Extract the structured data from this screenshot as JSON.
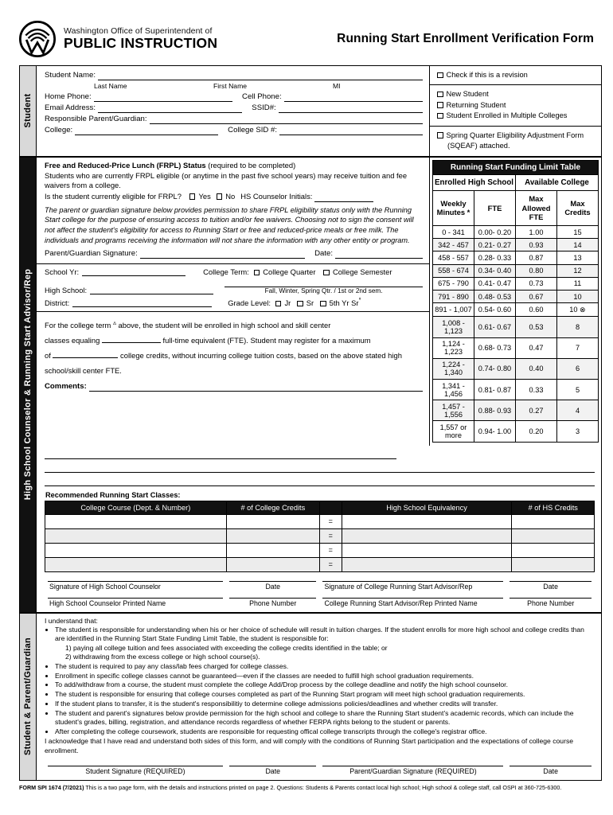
{
  "header": {
    "agency_line1": "Washington Office of Superintendent of",
    "agency_line2": "PUBLIC INSTRUCTION",
    "form_title": "Running Start Enrollment Verification Form",
    "logo_icon": "ospi-seal-icon"
  },
  "sidebars": {
    "student": "Student",
    "counselor": "High School Counselor & Running Start Advisor/Rep",
    "parent": "Student & Parent/Guardian"
  },
  "student": {
    "name_label": "Student Name:",
    "cap_last": "Last Name",
    "cap_first": "First Name",
    "cap_mi": "MI",
    "home_phone_label": "Home Phone:",
    "cell_phone_label": "Cell Phone:",
    "email_label": "Email Address:",
    "ssid_label": "SSID#:",
    "guardian_label": "Responsible Parent/Guardian:",
    "college_label": "College:",
    "college_sid_label": "College SID #:",
    "checks_group1": [
      "Check if this is a revision"
    ],
    "checks_group2": [
      "New Student",
      "Returning Student",
      "Student Enrolled in Multiple Colleges"
    ],
    "checks_group3": [
      "Spring Quarter Eligibility Adjustment Form (SQEAF) attached."
    ]
  },
  "frpl": {
    "heading_bold": "Free and Reduced-Price Lunch (FRPL) Status",
    "heading_rest": " (required to be completed)",
    "body": "Students who are currently FRPL eligible (or anytime in the past five school years) may receive tuition and fee waivers from a college.",
    "question": "Is the student currently eligible for FRPL?",
    "opt_yes": "Yes",
    "opt_no": "No",
    "initials_label": "HS Counselor Initials:",
    "consent": "The parent or guardian signature below provides permission to share FRPL eligibility status only with the Running Start college for the purpose of ensuring access to tuition and/or fee waivers. Choosing not to sign the consent will not affect the student's eligibility for access to Running Start or free and reduced-price meals or free milk. The individuals and programs receiving the information will not share the information with any other entity or program.",
    "signature_label": "Parent/Guardian Signature:",
    "date_label": "Date:"
  },
  "school": {
    "school_yr_label": "School Yr:",
    "college_term_label": "College Term:",
    "term_quarter": "College Quarter",
    "term_semester": "College Semester",
    "high_school_label": "High School:",
    "term_caption": "Fall, Winter, Spring Qtr. / 1st or 2nd sem.",
    "district_label": "District:",
    "grade_level_label": "Grade Level:",
    "grade_jr": "Jr",
    "grade_sr": "Sr",
    "grade_5th": "5th Yr Sr",
    "grade_5th_sup": "°"
  },
  "enrollment": {
    "line1_a": "For the college term ",
    "line1_sup": "▵",
    "line1_b": " above, the student will be enrolled in high school and skill center",
    "line2_a": "classes equaling",
    "line2_b": "full-time equivalent (FTE).  Student may register for a maximum",
    "line3_a": "of",
    "line3_b": "college credits, without incurring college tuition costs, based on the above stated high school/skill center FTE.",
    "comments_label": "Comments:"
  },
  "chart_data": {
    "type": "table",
    "title": "Running Start Funding Limit Table",
    "group_headers": [
      "Enrolled High School",
      "Available College"
    ],
    "columns": [
      "Weekly Minutes *",
      "FTE",
      "Max Allowed FTE",
      "Max Credits"
    ],
    "rows": [
      [
        "0 - 341",
        "0.00- 0.20",
        "1.00",
        "15"
      ],
      [
        "342 - 457",
        "0.21- 0.27",
        "0.93",
        "14"
      ],
      [
        "458 - 557",
        "0.28- 0.33",
        "0.87",
        "13"
      ],
      [
        "558 - 674",
        "0.34- 0.40",
        "0.80",
        "12"
      ],
      [
        "675 - 790",
        "0.41- 0.47",
        "0.73",
        "11"
      ],
      [
        "791 - 890",
        "0.48- 0.53",
        "0.67",
        "10"
      ],
      [
        "891 - 1,007",
        "0.54- 0.60",
        "0.60",
        "10 ⊗"
      ],
      [
        "1,008 - 1,123",
        "0.61- 0.67",
        "0.53",
        "8"
      ],
      [
        "1,124 - 1,223",
        "0.68- 0.73",
        "0.47",
        "7"
      ],
      [
        "1,224 - 1,340",
        "0.74- 0.80",
        "0.40",
        "6"
      ],
      [
        "1,341 - 1,456",
        "0.81- 0.87",
        "0.33",
        "5"
      ],
      [
        "1,457 - 1,556",
        "0.88- 0.93",
        "0.27",
        "4"
      ],
      [
        "1,557 or more",
        "0.94- 1.00",
        "0.20",
        "3"
      ]
    ]
  },
  "classes": {
    "label": "Recommended Running Start Classes:",
    "headers": [
      "College Course (Dept. & Number)",
      "# of College Credits",
      "",
      "High School Equivalency",
      "# of HS Credits"
    ],
    "eq_symbol": "=",
    "row_count": 4
  },
  "signatures": {
    "row1": [
      "Signature of High School Counselor",
      "Date",
      "Signature of College Running Start Advisor/Rep",
      "Date"
    ],
    "row2": [
      "High School Counselor Printed Name",
      "Phone Number",
      "College Running Start Advisor/Rep Printed Name",
      "Phone Number"
    ],
    "final": [
      "Student Signature (REQUIRED)",
      "Date",
      "Parent/Guardian Signature (REQUIRED)",
      "Date"
    ]
  },
  "acknowledgment": {
    "intro": "I understand that:",
    "bullets": [
      "The student is responsible for understanding when his or her choice of schedule will result in tuition charges. If the student enrolls for more high school and college credits than are identified in the Running Start State Funding Limit Table, the student is responsible for:",
      "The student is required to pay any class/lab fees charged for college classes.",
      "Enrollment in specific college classes cannot be guaranteed—even if the classes are needed to fulfill high school graduation requirements.",
      "To add/withdraw from a course, the student must complete the college Add/Drop process by the college deadline and notify the high school counselor.",
      "The student is responsible for ensuring that college courses completed as part of the Running Start program will meet high school graduation requirements.",
      "If the student plans to transfer, it is the student's responsibilitiy to determine college admissions policies/deadlines and whether credits will transfer.",
      "The student and parent's signatures below provide permission for the high school and college to share the Running Start student's academic records, which can include the student's grades, billing, registration, and attendance records regardless of whether FERPA rights belong to the student or parents.",
      "After completing the college coursework, students are responsible for requesting offical college transcripts through the college's registrar office."
    ],
    "sub_items": [
      "1) paying all college tuition and fees associated with exceeding the college credits identified in the table; or",
      "2) withdrawing from the excess college or high school course(s)."
    ],
    "closing": "I acknowledge that I have read and understand both sides of this form, and will comply with the conditions of Running Start participation and the expectations of college course enrollment."
  },
  "footer": {
    "form_id": "FORM SPI 1674 (7/2021)",
    "text": " This is a two page form, with the details and instructions printed on page 2. Questions:  Students & Parents contact local high school; High school & college staff, call OSPI at 360-725-6300."
  }
}
